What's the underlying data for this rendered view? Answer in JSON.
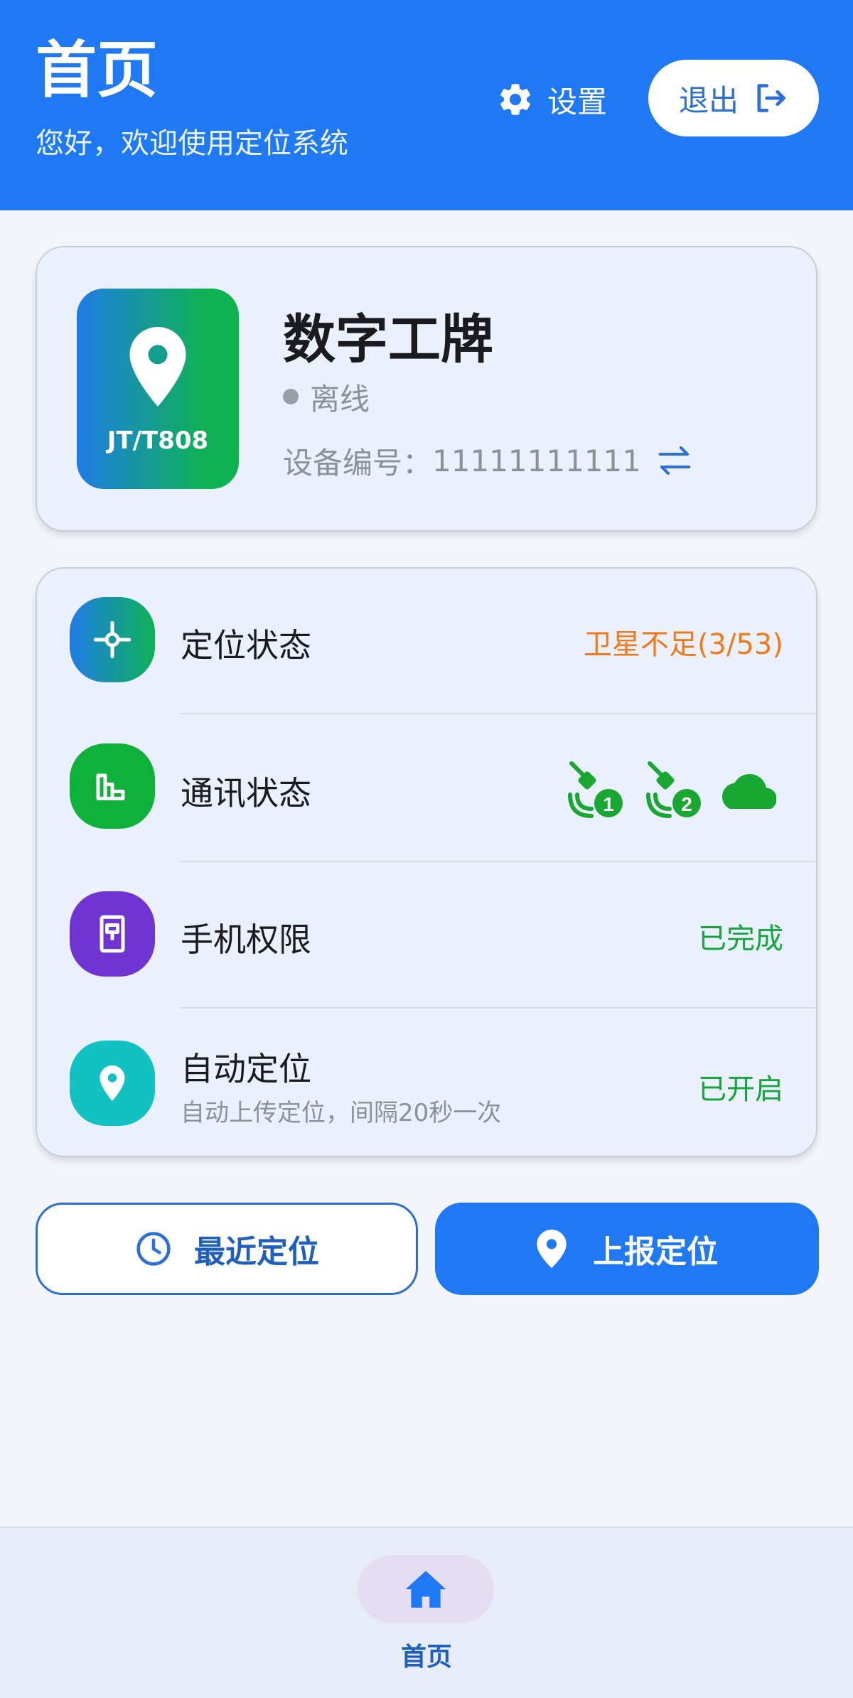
{
  "header": {
    "title": "首页",
    "subtitle": "您好，欢迎使用定位系统",
    "settings_label": "设置",
    "logout_label": "退出",
    "background_color": "#2079f4"
  },
  "device": {
    "logo_text": "JT/T808",
    "name": "数字工牌",
    "status": "离线",
    "number_label": "设备编号：",
    "number": "11111111111"
  },
  "status_rows": [
    {
      "label": "定位状态",
      "value": "卫星不足(3/53)",
      "value_color": "#f07a18",
      "icon": "crosshair-icon"
    },
    {
      "label": "通讯状态",
      "icons": [
        "network-1-icon",
        "network-2-icon",
        "cloud-icon"
      ],
      "badges": [
        "1",
        "2"
      ],
      "icon": "bar-chart-icon"
    },
    {
      "label": "手机权限",
      "value": "已完成",
      "value_color": "#15a53a",
      "icon": "phone-permission-icon"
    },
    {
      "label": "自动定位",
      "sublabel": "自动上传定位，间隔20秒一次",
      "value": "已开启",
      "value_color": "#15a53a",
      "icon": "location-pin-icon"
    }
  ],
  "actions": {
    "recent_label": "最近定位",
    "report_label": "上报定位"
  },
  "nav": {
    "home_label": "首页",
    "active": "home"
  }
}
